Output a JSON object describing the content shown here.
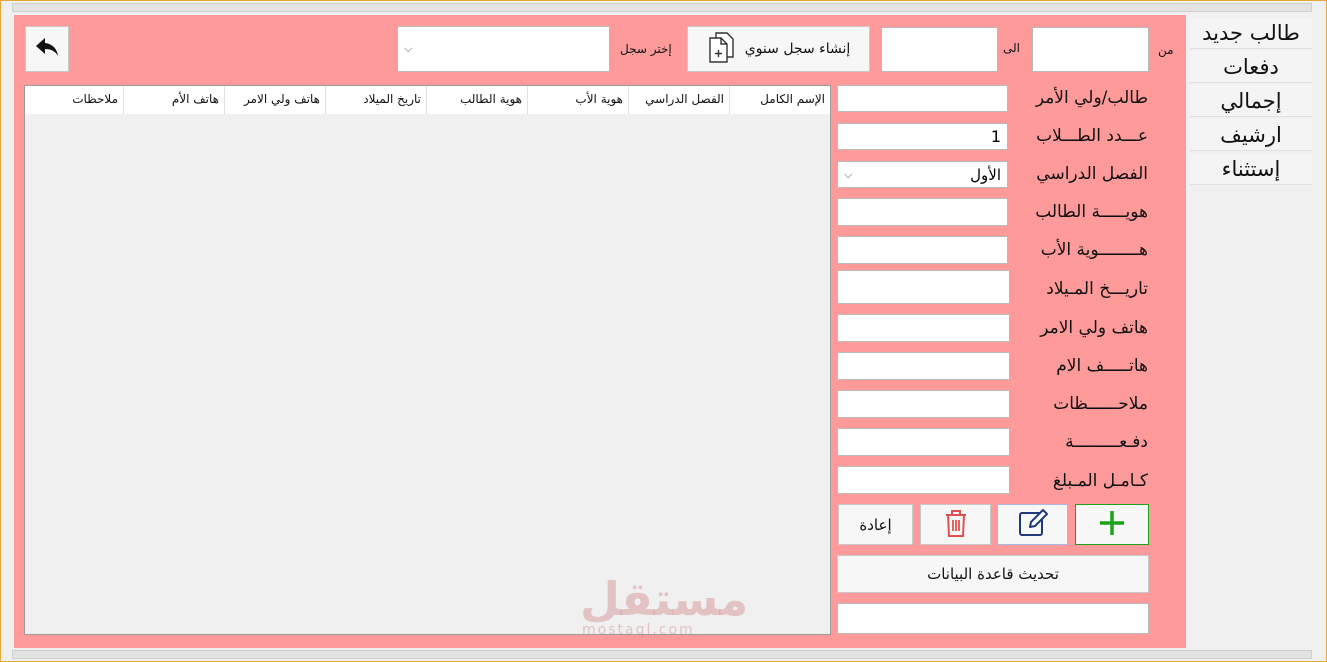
{
  "sidebar": {
    "items": [
      {
        "label": "طالب جديد"
      },
      {
        "label": "دفعات"
      },
      {
        "label": "إجمالي"
      },
      {
        "label": "ارشيف"
      },
      {
        "label": "إستثناء"
      }
    ]
  },
  "header": {
    "from_label": "من",
    "to_label": "الى",
    "create_record_label": "إنشاء سجل سنوي",
    "choose_record_label": "إختر سجل",
    "from_value": "",
    "to_value": "",
    "choose_record_value": ""
  },
  "form": {
    "fields": [
      {
        "label": "طالب/ولي الأمر",
        "value": ""
      },
      {
        "label": "عـــدد الطـــلاب",
        "value": "1"
      },
      {
        "label": "الفصل الدراسي",
        "value": "الأول"
      },
      {
        "label": "هويـــــة الطالب",
        "value": ""
      },
      {
        "label": "هــــــــوية الأب",
        "value": ""
      },
      {
        "label": "تاريـــخ المـيلاد",
        "value": ""
      },
      {
        "label": "هاتف ولي الامر",
        "value": ""
      },
      {
        "label": "هاتـــــف الام",
        "value": ""
      },
      {
        "label": "ملاحــــــظات",
        "value": ""
      },
      {
        "label": "دفـعـــــــــة",
        "value": ""
      },
      {
        "label": "كـامـل المـبلغ",
        "value": ""
      }
    ],
    "reset_label": "إعادة",
    "update_db_label": "تحديث قاعدة البيانات",
    "bottom_value": ""
  },
  "table": {
    "columns": [
      "الإسم الكامل",
      "الفصل الدراسي",
      "هوية الأب",
      "هوية الطالب",
      "تاريخ الميلاد",
      "هاتف ولي الامر",
      "هاتف الأم",
      "ملاحظات"
    ]
  },
  "watermark": {
    "text": "مستقل",
    "sub": "mostaql.com"
  },
  "colors": {
    "panel": "#ff9a9a",
    "add_green": "#1aa31a",
    "edit_blue": "#1e3a7a",
    "delete_red": "#e05050"
  }
}
